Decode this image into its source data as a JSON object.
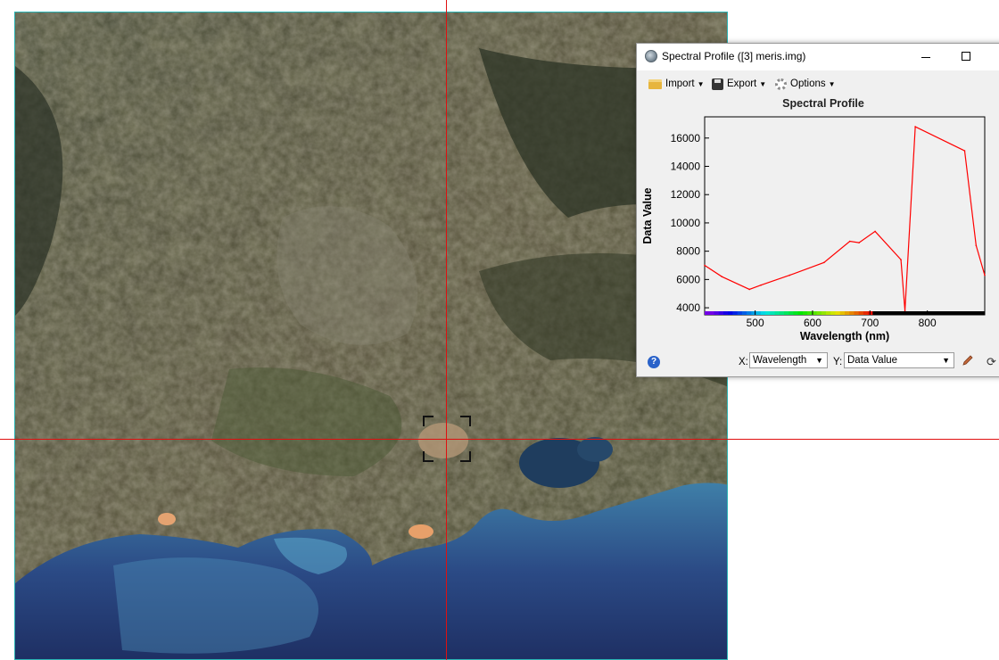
{
  "window": {
    "title": "Spectral Profile ([3] meris.img)",
    "icon": "app-globe-icon"
  },
  "toolbar": {
    "import_label": "Import",
    "export_label": "Export",
    "options_label": "Options"
  },
  "chart": {
    "title": "Spectral Profile",
    "xlabel": "Wavelength (nm)",
    "ylabel": "Data Value"
  },
  "chart_data": {
    "type": "line",
    "title": "Spectral Profile",
    "xlabel": "Wavelength (nm)",
    "ylabel": "Data Value",
    "xlim": [
      412,
      900
    ],
    "ylim": [
      3500,
      17500
    ],
    "x_ticks": [
      500,
      600,
      700,
      800
    ],
    "y_ticks": [
      4000,
      6000,
      8000,
      10000,
      12000,
      14000,
      16000
    ],
    "grid": false,
    "colorbar_below_axis": true,
    "series": [
      {
        "color": "#ff0000",
        "x": [
          412,
          442,
          490,
          510,
          560,
          620,
          665,
          681,
          709,
          754,
          761,
          779,
          865,
          885,
          900
        ],
        "y": [
          7000,
          6200,
          5300,
          5600,
          6300,
          7200,
          8700,
          8600,
          9400,
          7400,
          3800,
          16800,
          15100,
          8400,
          6300
        ]
      }
    ]
  },
  "bottom": {
    "x_label": "X:",
    "x_selected": "Wavelength",
    "y_label": "Y:",
    "y_selected": "Data Value"
  },
  "crosshair_color": "#e01010"
}
